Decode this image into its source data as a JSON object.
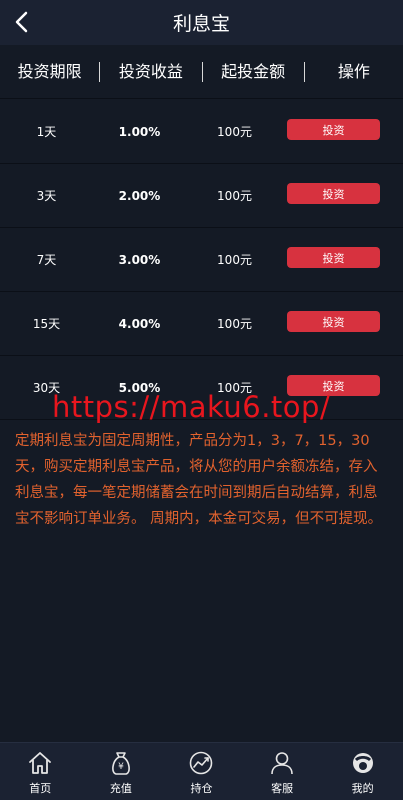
{
  "header": {
    "title": "利息宝"
  },
  "table": {
    "columns": [
      "投资期限",
      "投资收益",
      "起投金额",
      "操作"
    ],
    "rows": [
      {
        "period": "1天",
        "rate": "1.00%",
        "min": "100元",
        "action": "投资"
      },
      {
        "period": "3天",
        "rate": "2.00%",
        "min": "100元",
        "action": "投资"
      },
      {
        "period": "7天",
        "rate": "3.00%",
        "min": "100元",
        "action": "投资"
      },
      {
        "period": "15天",
        "rate": "4.00%",
        "min": "100元",
        "action": "投资"
      },
      {
        "period": "30天",
        "rate": "5.00%",
        "min": "100元",
        "action": "投资"
      }
    ]
  },
  "watermark": "https://maku6.top/",
  "notice": "定期利息宝为固定周期性，产品分为1，3，7，15，30天，购买定期利息宝产品，将从您的用户余额冻结，存入利息宝，每一笔定期储蓄会在时间到期后自动结算，利息宝不影响订单业务。 周期内，本金可交易，但不可提现。",
  "nav": [
    {
      "label": "首页",
      "icon": "home-icon"
    },
    {
      "label": "充值",
      "icon": "money-bag-icon"
    },
    {
      "label": "持仓",
      "icon": "chart-icon"
    },
    {
      "label": "客服",
      "icon": "user-icon"
    },
    {
      "label": "我的",
      "icon": "profile-icon"
    }
  ],
  "colors": {
    "background": "#141a25",
    "bar": "#1b2232",
    "button": "#d7323f",
    "notice_text": "#e1622e",
    "watermark": "#e8161e"
  }
}
